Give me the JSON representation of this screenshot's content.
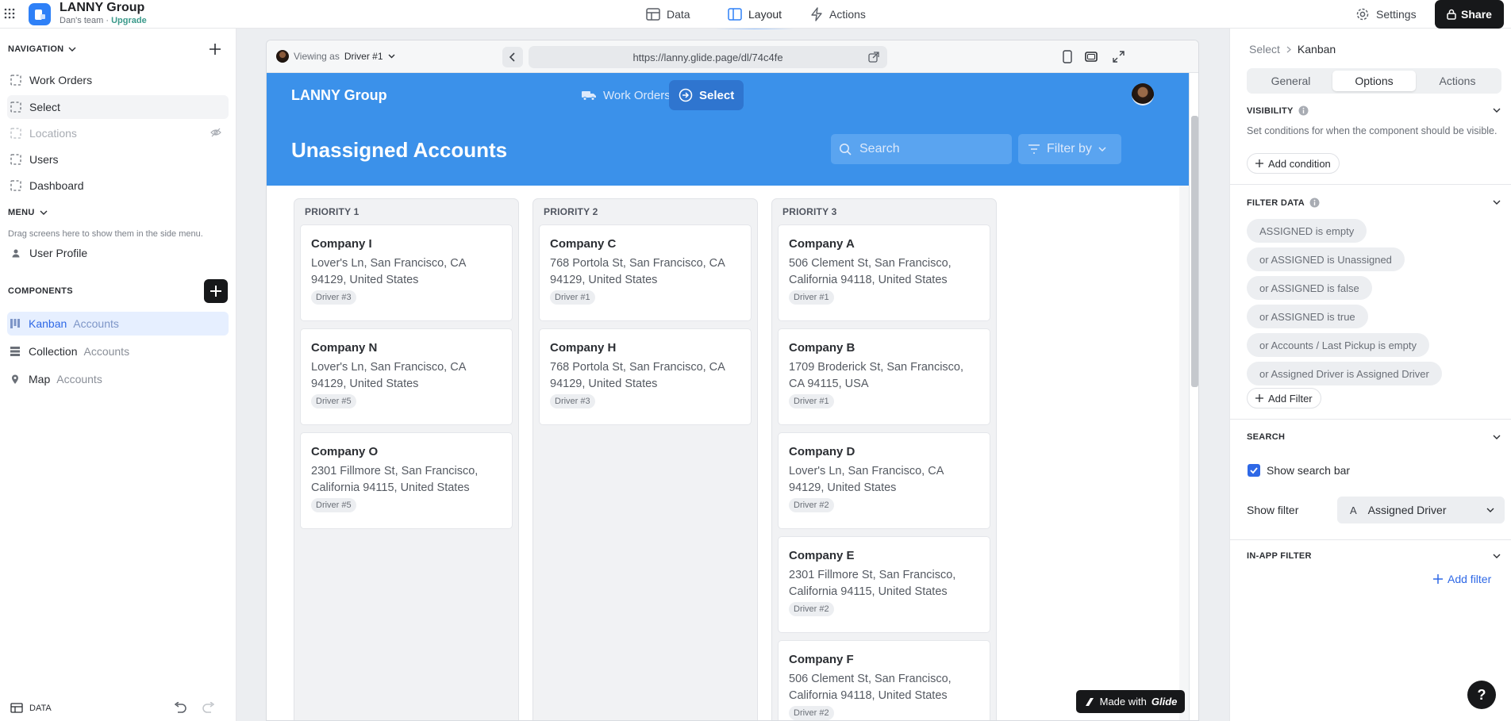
{
  "app": {
    "name": "LANNY Group",
    "team": "Dan's team",
    "separator": " · ",
    "upgrade": "Upgrade"
  },
  "top_tabs": [
    {
      "label": "Data",
      "icon": "table-icon"
    },
    {
      "label": "Layout",
      "icon": "layout-icon"
    },
    {
      "label": "Actions",
      "icon": "bolt-icon"
    }
  ],
  "topbar": {
    "settings": "Settings",
    "share": "Share"
  },
  "navigation": {
    "title": "NAVIGATION",
    "items": [
      {
        "label": "Work Orders",
        "state": "normal"
      },
      {
        "label": "Select",
        "state": "selected"
      },
      {
        "label": "Locations",
        "state": "hidden"
      },
      {
        "label": "Users",
        "state": "normal"
      },
      {
        "label": "Dashboard",
        "state": "normal"
      }
    ]
  },
  "menu": {
    "title": "MENU",
    "hint": "Drag screens here to show them in the side menu.",
    "items": [
      {
        "label": "User Profile"
      }
    ]
  },
  "components": {
    "title": "COMPONENTS",
    "items": [
      {
        "label": "Kanban",
        "source": "Accounts",
        "icon": "kanban-icon"
      },
      {
        "label": "Collection",
        "source": "Accounts",
        "icon": "collection-icon"
      },
      {
        "label": "Map",
        "source": "Accounts",
        "icon": "map-pin-icon"
      }
    ]
  },
  "bottom": {
    "data_label": "DATA"
  },
  "preview": {
    "viewing_as": "Viewing as",
    "viewing_user": "Driver #1",
    "url": "https://lanny.glide.page/dl/74c4fe"
  },
  "appview": {
    "brand": "LANNY Group",
    "nav": [
      {
        "label": "Work Orders",
        "icon": "truck-icon"
      },
      {
        "label": "Select",
        "icon": "arrow-circle-icon"
      }
    ],
    "title": "Unassigned Accounts",
    "search_placeholder": "Search",
    "filter_label": "Filter by",
    "made_with": "Made with",
    "made_brand": "Glide"
  },
  "kanban": {
    "columns": [
      {
        "title": "PRIORITY 1",
        "cards": [
          {
            "name": "Company I",
            "address": "Lover's Ln, San Francisco, CA 94129, United States",
            "driver": "Driver #3"
          },
          {
            "name": "Company N",
            "address": "Lover's Ln, San Francisco, CA 94129, United States",
            "driver": "Driver #5"
          },
          {
            "name": "Company O",
            "address": "2301 Fillmore St, San Francisco, California 94115, United States",
            "driver": "Driver #5"
          }
        ]
      },
      {
        "title": "PRIORITY 2",
        "cards": [
          {
            "name": "Company C",
            "address": "768 Portola St, San Francisco, CA 94129, United States",
            "driver": "Driver #1"
          },
          {
            "name": "Company H",
            "address": "768 Portola St, San Francisco, CA 94129, United States",
            "driver": "Driver #3"
          }
        ]
      },
      {
        "title": "PRIORITY 3",
        "cards": [
          {
            "name": "Company A",
            "address": "506 Clement St, San Francisco, California 94118, United States",
            "driver": "Driver #1"
          },
          {
            "name": "Company B",
            "address": "1709 Broderick St, San Francisco, CA 94115, USA",
            "driver": "Driver #1"
          },
          {
            "name": "Company D",
            "address": "Lover's Ln, San Francisco, CA 94129, United States",
            "driver": "Driver #2"
          },
          {
            "name": "Company E",
            "address": "2301 Fillmore St, San Francisco, California 94115, United States",
            "driver": "Driver #2"
          },
          {
            "name": "Company F",
            "address": "506 Clement St, San Francisco, California 94118, United States",
            "driver": "Driver #2"
          }
        ]
      }
    ]
  },
  "inspector": {
    "breadcrumb": [
      "Select",
      "Kanban"
    ],
    "tabs": [
      {
        "label": "General"
      },
      {
        "label": "Options",
        "selected": true
      },
      {
        "label": "Actions"
      }
    ],
    "visibility": {
      "title": "VISIBILITY",
      "description": "Set conditions for when the component should be visible.",
      "add_condition": "Add condition"
    },
    "filter_data": {
      "title": "FILTER DATA",
      "filters": [
        "ASSIGNED is empty",
        "or ASSIGNED is Unassigned",
        "or ASSIGNED is false",
        "or ASSIGNED is true",
        "or Accounts / Last Pickup is empty",
        "or Assigned Driver is Assigned Driver"
      ],
      "add_filter": "Add Filter"
    },
    "search": {
      "title": "SEARCH",
      "show_search_bar": "Show search bar",
      "show_search_bar_checked": true,
      "show_filter_label": "Show filter",
      "show_filter_value": "Assigned Driver",
      "show_filter_type_glyph": "A"
    },
    "in_app_filter": {
      "title": "IN-APP FILTER",
      "add_filter": "Add filter"
    }
  },
  "help_label": "?",
  "colors": {
    "accent": "#2e80f7",
    "app_header": "#3b91ea",
    "selected_component": "#e6efff",
    "link": "#2e68e6"
  }
}
